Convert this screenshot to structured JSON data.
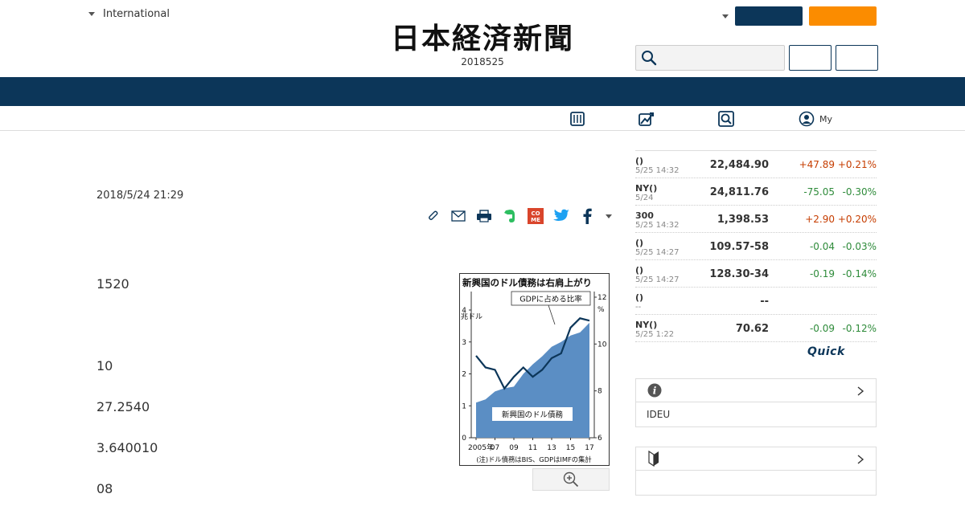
{
  "header": {
    "edition_label": "International",
    "logo_text": "日本経済新聞",
    "date_text": "2018525"
  },
  "subnav": {
    "my_label": "My"
  },
  "article": {
    "date": "2018/5/24 21:29",
    "paragraphs": [
      "1520",
      "10",
      "27.2540",
      "3.640010",
      "08"
    ]
  },
  "chart": {
    "title": "新興国のドル債務は右肩上がり",
    "callout": "GDPに占める比率",
    "left_unit": "兆ドル",
    "right_unit": "%",
    "area_label": "新興国のドル債務",
    "note": "(注)ドル債務はBIS、GDPはIMFの集計",
    "left_ticks": [
      "0",
      "1",
      "2",
      "3",
      "4"
    ],
    "right_ticks": [
      "6",
      "8",
      "10",
      "12"
    ],
    "x_ticks": [
      "2005年",
      "07",
      "09",
      "11",
      "13",
      "15",
      "17"
    ]
  },
  "chart_data": {
    "type": "area",
    "title": "新興国のドル債務は右肩上がり",
    "x": [
      2005,
      2006,
      2007,
      2008,
      2009,
      2010,
      2011,
      2012,
      2013,
      2014,
      2015,
      2016,
      2017
    ],
    "series": [
      {
        "name": "新興国のドル債務",
        "axis": "left",
        "values": [
          1.1,
          1.2,
          1.45,
          1.55,
          1.6,
          2.0,
          2.3,
          2.55,
          2.85,
          3.0,
          3.2,
          3.3,
          3.6
        ]
      },
      {
        "name": "GDPに占める比率",
        "axis": "right",
        "values": [
          9.5,
          9.0,
          8.9,
          8.1,
          8.6,
          9.0,
          8.6,
          8.9,
          9.4,
          9.6,
          10.7,
          11.1,
          11.0
        ]
      }
    ],
    "ylabel": "兆ドル",
    "y2label": "%",
    "ylim": [
      0,
      4
    ],
    "y2lim": [
      6,
      12
    ]
  },
  "market": [
    {
      "name": "()",
      "time": "5/25 14:32",
      "value": "22,484.90",
      "change": "+47.89",
      "pct": "+0.21%",
      "dir": "up"
    },
    {
      "name": "NY()",
      "time": "5/24",
      "value": "24,811.76",
      "change": "-75.05",
      "pct": "-0.30%",
      "dir": "down"
    },
    {
      "name": "300",
      "time": "5/25 14:32",
      "value": "1,398.53",
      "change": "+2.90",
      "pct": "+0.20%",
      "dir": "up"
    },
    {
      "name": "()",
      "time": "5/25 14:27",
      "value": "109.57-58",
      "change": "-0.04",
      "pct": "-0.03%",
      "dir": "down"
    },
    {
      "name": "()",
      "time": "5/25 14:27",
      "value": "128.30-34",
      "change": "-0.19",
      "pct": "-0.14%",
      "dir": "down"
    },
    {
      "name": "()",
      "time": "--",
      "value": "--",
      "change": "",
      "pct": "",
      "dir": "none"
    },
    {
      "name": "NY()",
      "time": "5/25 1:22",
      "value": "70.62",
      "change": "-0.09",
      "pct": "-0.12%",
      "dir": "down"
    }
  ],
  "quick_label": "Quick",
  "info_panel": {
    "body": "IDEU"
  },
  "colors": {
    "navy": "#0c3659",
    "orange": "#fb8c00",
    "up": "#c63d00",
    "down": "#2e8b3a",
    "chart_area": "#5b8ec4",
    "chart_line": "#0c3659"
  }
}
